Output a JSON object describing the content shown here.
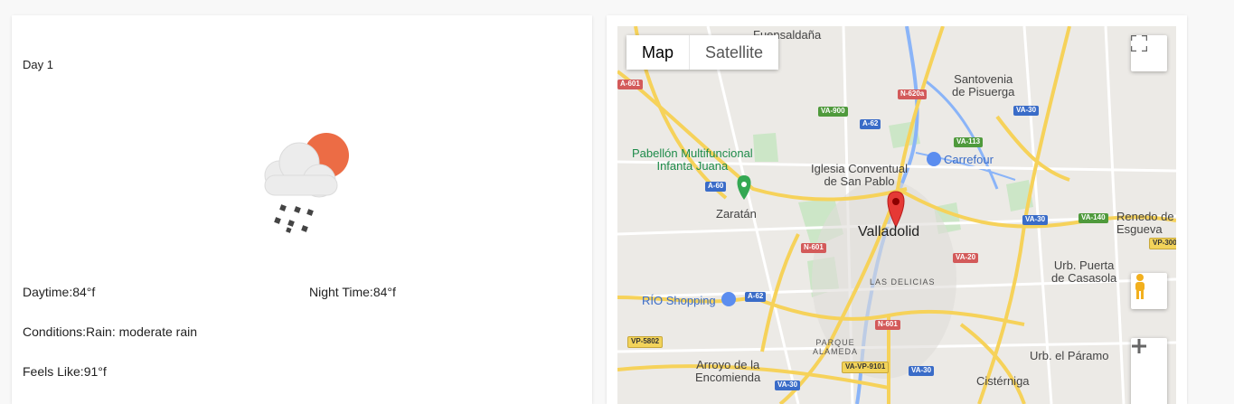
{
  "weather": {
    "day_title": "Day 1",
    "daytime_label": "Daytime:",
    "daytime_value": "84°f",
    "night_label": "Night Time:",
    "night_value": "84°f",
    "conditions_label": "Conditions:",
    "conditions_value": "Rain: moderate rain",
    "feels_label": "Feels Like:",
    "feels_value": "91°f",
    "icon": "rain-sun-icon"
  },
  "map": {
    "map_type_buttons": [
      {
        "label": "Map",
        "active": true
      },
      {
        "label": "Satellite",
        "active": false
      }
    ],
    "labels": {
      "fuensaldana": "Fuensaldaña",
      "santovenia": "Santovenia\nde Pisuerga",
      "pabellon": "Pabellón Multifuncional\nInfanta Juana",
      "iglesia": "Iglesia Conventual\nde San Pablo",
      "carrefour": "Carrefour",
      "zaratan": "Zaratán",
      "valladolid": "Valladolid",
      "renedo": "Renedo de\nEsgueva",
      "urb_puerta": "Urb. Puerta\nde Casasola",
      "delicias": "LAS DELICIAS",
      "rio": "RÍO Shopping",
      "parque": "PARQUE\nALAMEDA",
      "arroyo": "Arroyo de la\nEncomienda",
      "paramo": "Urb. el Páramo",
      "cisterniga": "Cistérniga"
    },
    "shields": {
      "a601": "A-601",
      "n620a": "N-620a",
      "va900": "VA-900",
      "a62a": "A-62",
      "va30a": "VA-30",
      "va113": "VA-113",
      "a60": "A-60",
      "n601a": "N-601",
      "va30b": "VA-30",
      "va140": "VA-140",
      "vp300": "VP-300",
      "va20": "VA-20",
      "a62b": "A-62",
      "n601b": "N-601",
      "vp5802": "VP-5802",
      "vavp9101": "VA-VP-9101",
      "va30c": "VA-30",
      "va30d": "VA-30"
    },
    "colors": {
      "road_major": "#f6d25a",
      "water": "#8ab4f8",
      "park": "#c9e6c4",
      "marker": "#e53935",
      "green_marker": "#34a853"
    }
  }
}
